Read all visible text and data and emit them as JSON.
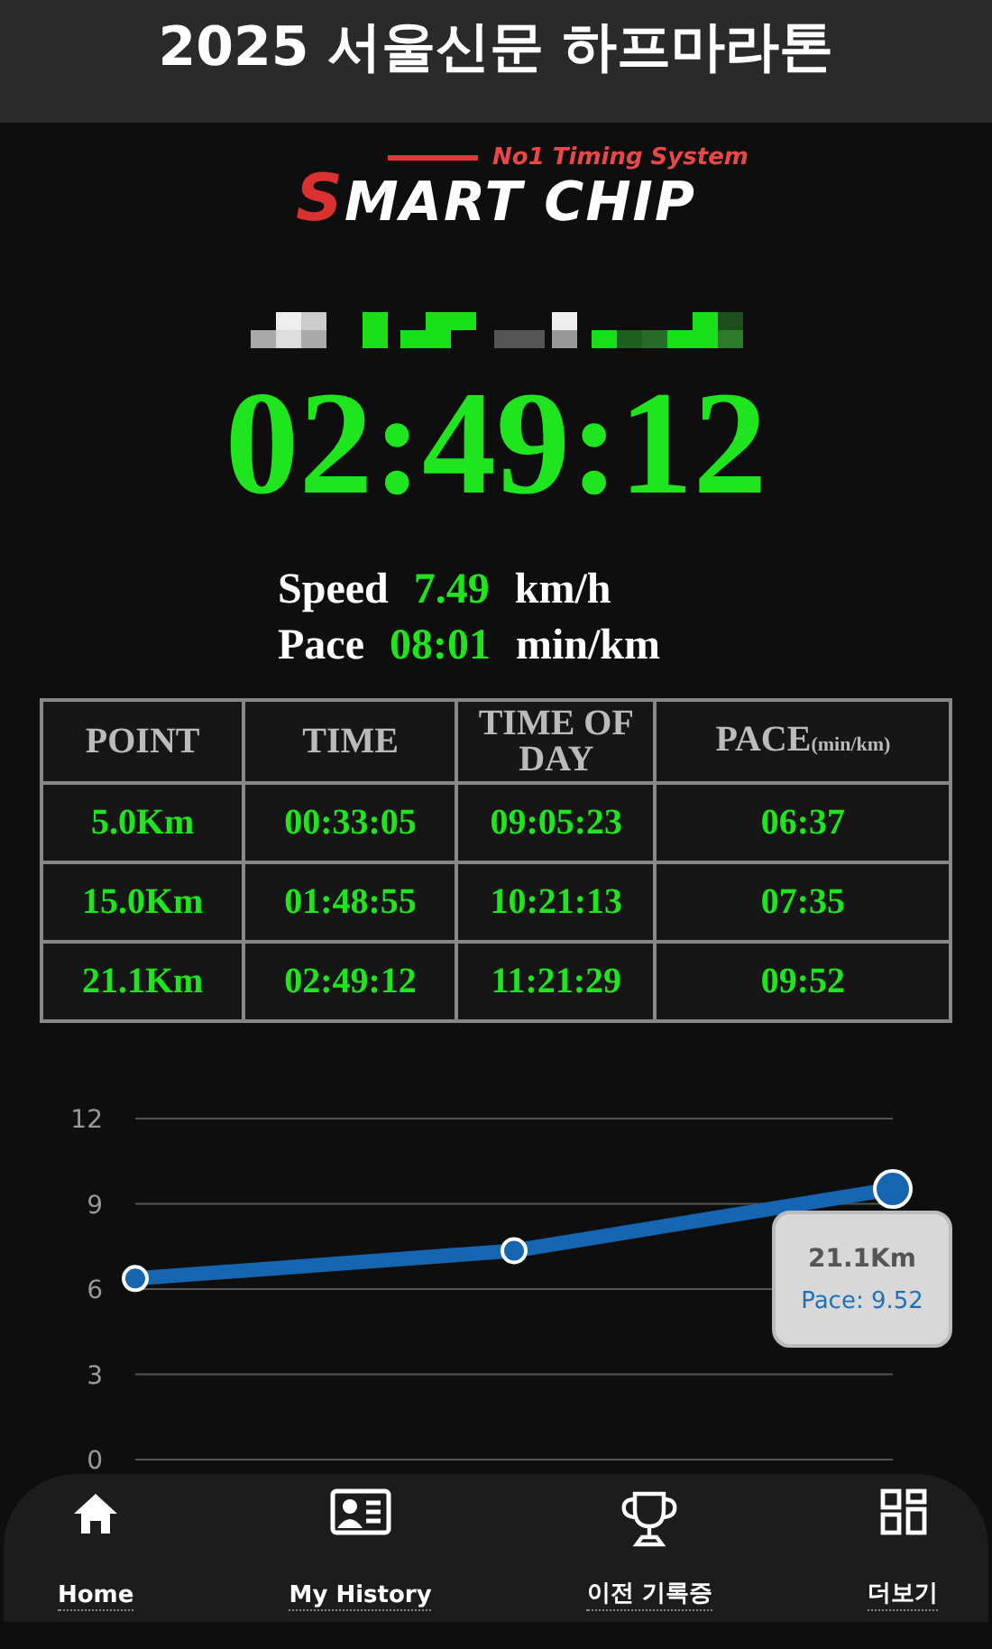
{
  "header": {
    "title": "2025 서울신문 하프마라톤"
  },
  "logo": {
    "tagline": "No1 Timing System",
    "wordmark": "SMART CHIP"
  },
  "finish_time": "02:49:12",
  "stats": [
    {
      "label": "Speed",
      "value": "7.49",
      "unit": "km/h"
    },
    {
      "label": "Pace",
      "value": "08:01",
      "unit": "min/km"
    }
  ],
  "table": {
    "columns": [
      {
        "text": "POINT"
      },
      {
        "text": "TIME"
      },
      {
        "text": "TIME OF DAY"
      },
      {
        "text": "PACE$_{(min/km)}$"
      }
    ],
    "rows": [
      [
        "5.0Km",
        "00:33:05",
        "09:05:23",
        "06:37"
      ],
      [
        "15.0Km",
        "01:48:55",
        "10:21:13",
        "07:35"
      ],
      [
        "21.1Km",
        "02:49:12",
        "11:21:29",
        "09:52"
      ]
    ]
  },
  "chart": {
    "chart_data": {
      "type": "line",
      "grid": true,
      "series": [
        {
          "color": "#1565b0",
          "marker": true,
          "values": [
            6.37,
            7.35,
            9.52
          ]
        }
      ],
      "ylim": [
        0,
        12
      ],
      "yticks": [
        0,
        3,
        6,
        9,
        12
      ]
    },
    "tooltip": {
      "title": "21.1Km",
      "value": "Pace: 9.52"
    }
  },
  "nav": [
    {
      "label": "Home",
      "kind": "home"
    },
    {
      "label": "My History",
      "kind": "history"
    },
    {
      "label": "이전 기록증",
      "kind": "certificate"
    },
    {
      "label": "더보기",
      "kind": "more"
    }
  ]
}
